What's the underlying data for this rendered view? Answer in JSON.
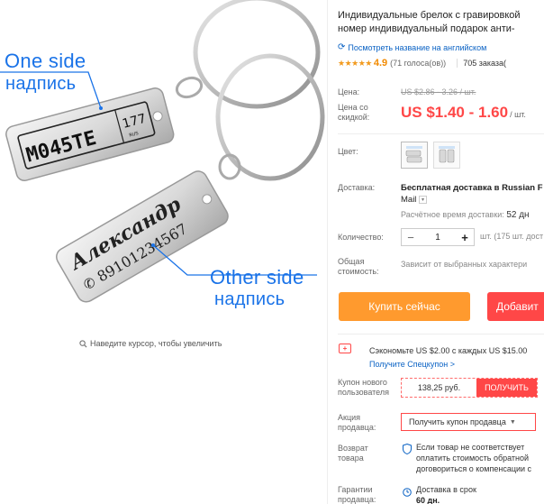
{
  "image": {
    "annotation_one_side_en": "One side",
    "annotation_one_side_ru": "надпись",
    "annotation_other_side_en": "Other side",
    "annotation_other_side_ru": "надпись",
    "plate_number": "M045TE",
    "plate_region": "177",
    "plate_country": "RUS",
    "engraved_name": "Александр",
    "engraved_phone": "89101234567",
    "zoom_hint": "Наведите курсор, чтобы увеличить"
  },
  "product": {
    "title_line1": "Индивидуальные брелок с гравировкой",
    "title_line2": "номер индивидуальный подарок анти-",
    "translate_link": "Посмотреть название на английском",
    "rating": "4.9",
    "votes": "(71 голоса(ов))",
    "orders": "705 заказа(",
    "stars": "★★★★★"
  },
  "pricing": {
    "price_label": "Цена:",
    "price_old": "US $2.86 - 3.26 / шт.",
    "discount_label_1": "Цена со",
    "discount_label_2": "скидкой:",
    "price_new": "US $1.40 - 1.60",
    "price_unit": "/ шт."
  },
  "options": {
    "color_label": "Цвет:",
    "shipping_label": "Доставка:",
    "shipping_free_1": "Бесплатная доставка в Russian F",
    "shipping_free_2": "Mail",
    "shipping_time_label": "Расчётное время доставки:",
    "shipping_time_value": "52 дн",
    "quantity_label": "Количество:",
    "quantity_value": "1",
    "quantity_minus": "−",
    "quantity_plus": "+",
    "quantity_available": "шт. (175 шт. дост",
    "total_label_1": "Общая",
    "total_label_2": "стоимость:",
    "total_value": "Зависит от выбранных характери"
  },
  "actions": {
    "buy_now": "Купить сейчас",
    "add_to_cart": "Добавит"
  },
  "coupons": {
    "save_text": "Сэкономьте US $2.00 с каждых US $15.00",
    "coupon_link": "Получите Спецкупон >",
    "new_user_label_1": "Купон нового",
    "new_user_label_2": "пользователя",
    "new_user_amount": "138,25 руб.",
    "new_user_button": "ПОЛУЧИТЬ",
    "seller_label_1": "Акция",
    "seller_label_2": "продавца:",
    "seller_select": "Получить купон продавца",
    "return_label_1": "Возврат",
    "return_label_2": "товара",
    "return_line1": "Если товар не соответствует",
    "return_line2": "оплатить стоимость обратной",
    "return_line3": "договориться о компенсации с",
    "guarantee_label_1": "Гарантии",
    "guarantee_label_2": "продавца:",
    "guarantee_line1": "Доставка в срок",
    "guarantee_line2": "60 дн."
  },
  "colors": {
    "accent_red": "#ff4747",
    "buy_orange": "#ff9a2e",
    "link_blue": "#0a62c4",
    "annotation_blue": "#1a73e8",
    "star_gold": "#f29a1d"
  }
}
